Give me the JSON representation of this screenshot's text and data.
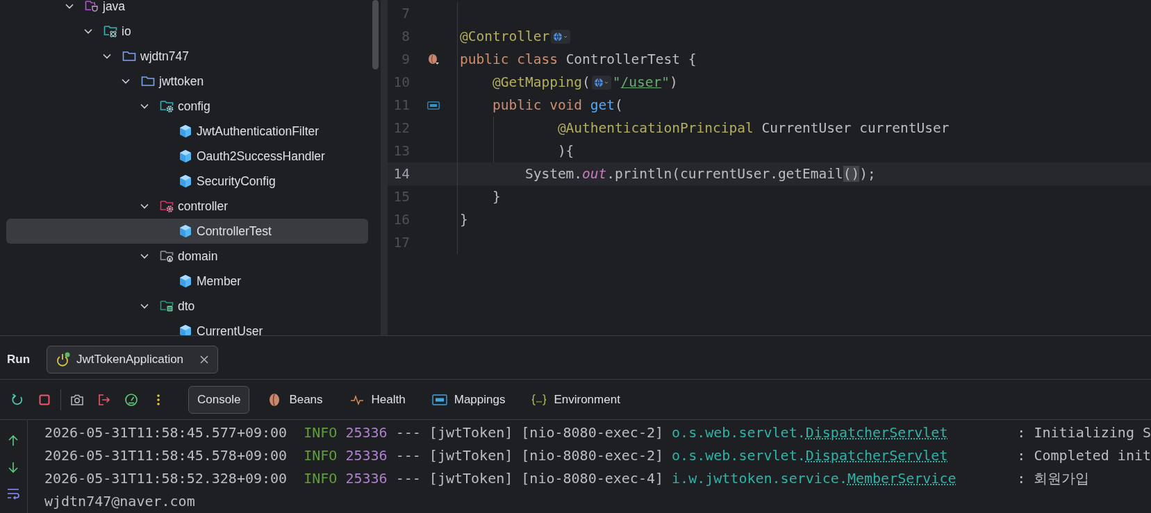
{
  "tree": [
    {
      "label": "java",
      "kind": "source-root",
      "expanded": true,
      "selected": false,
      "children": [
        {
          "label": "io",
          "kind": "atom-package",
          "expanded": true,
          "selected": false,
          "children": [
            {
              "label": "wjdtn747",
              "kind": "folder",
              "expanded": true,
              "selected": false,
              "children": [
                {
                  "label": "jwttoken",
                  "kind": "folder",
                  "expanded": true,
                  "selected": false,
                  "children": [
                    {
                      "label": "config",
                      "kind": "config-folder",
                      "expanded": true,
                      "selected": false,
                      "children": [
                        {
                          "label": "JwtAuthenticationFilter",
                          "kind": "class",
                          "selected": false
                        },
                        {
                          "label": "Oauth2SuccessHandler",
                          "kind": "class",
                          "selected": false
                        },
                        {
                          "label": "SecurityConfig",
                          "kind": "class",
                          "selected": false
                        }
                      ]
                    },
                    {
                      "label": "controller",
                      "kind": "controller-folder",
                      "expanded": true,
                      "selected": false,
                      "children": [
                        {
                          "label": "ControllerTest",
                          "kind": "class",
                          "selected": true
                        }
                      ]
                    },
                    {
                      "label": "domain",
                      "kind": "domain-folder",
                      "expanded": true,
                      "selected": false,
                      "children": [
                        {
                          "label": "Member",
                          "kind": "class",
                          "selected": false
                        }
                      ]
                    },
                    {
                      "label": "dto",
                      "kind": "dto-folder",
                      "expanded": true,
                      "selected": false,
                      "children": [
                        {
                          "label": "CurrentUser",
                          "kind": "class",
                          "selected": false
                        }
                      ]
                    }
                  ]
                }
              ]
            }
          ]
        }
      ]
    }
  ],
  "editor": {
    "lines": [
      {
        "number": "7",
        "kind": "plain",
        "current": false
      },
      {
        "number": "8",
        "kind": "plain",
        "current": false,
        "tokens": [
          {
            "kind": "annotation",
            "text": "@Controller"
          },
          {
            "kind": "inlay"
          }
        ]
      },
      {
        "number": "9",
        "kind": "bean",
        "current": false,
        "tokens": [
          {
            "kind": "keyword",
            "text": "public class "
          },
          {
            "kind": "plain",
            "text": "ControllerTest {"
          }
        ]
      },
      {
        "number": "10",
        "kind": "plain",
        "current": false,
        "tokens": [
          {
            "kind": "annotation",
            "text": "    @GetMapping"
          },
          {
            "kind": "plain",
            "text": "("
          },
          {
            "kind": "inlay"
          },
          {
            "kind": "string",
            "text": "\""
          },
          {
            "kind": "link",
            "text": "/user"
          },
          {
            "kind": "string",
            "text": "\""
          },
          {
            "kind": "plain",
            "text": ")"
          }
        ]
      },
      {
        "number": "11",
        "kind": "api",
        "current": false,
        "tokens": [
          {
            "kind": "keyword",
            "text": "    public void "
          },
          {
            "kind": "method",
            "text": "get"
          },
          {
            "kind": "plain",
            "text": "("
          }
        ]
      },
      {
        "number": "12",
        "kind": "plain",
        "current": false,
        "tokens": [
          {
            "kind": "annotation",
            "text": "            @AuthenticationPrincipal "
          },
          {
            "kind": "plain",
            "text": "CurrentUser currentUser"
          }
        ]
      },
      {
        "number": "13",
        "kind": "plain",
        "current": false,
        "tokens": [
          {
            "kind": "plain",
            "text": "            ){"
          }
        ]
      },
      {
        "number": "14",
        "kind": "plain",
        "current": true,
        "tokens": [
          {
            "kind": "plain",
            "text": "        System."
          },
          {
            "kind": "field",
            "text": "out"
          },
          {
            "kind": "plain",
            "text": ".println(currentUser.getEmail"
          },
          {
            "kind": "match",
            "text": "()"
          },
          {
            "kind": "plain",
            "text": ");"
          }
        ]
      },
      {
        "number": "15",
        "kind": "plain",
        "current": false,
        "tokens": [
          {
            "kind": "plain",
            "text": "    }"
          }
        ]
      },
      {
        "number": "16",
        "kind": "plain",
        "current": false,
        "tokens": [
          {
            "kind": "plain",
            "text": "}"
          }
        ]
      },
      {
        "number": "17",
        "kind": "plain",
        "current": false
      }
    ]
  },
  "run": {
    "title": "Run",
    "tab": {
      "label": "JwtTokenApplication",
      "running": true
    },
    "view_tabs": [
      {
        "label": "Console",
        "kind": "console",
        "selected": true
      },
      {
        "label": "Beans",
        "kind": "bean",
        "selected": false
      },
      {
        "label": "Health",
        "kind": "health",
        "selected": false
      },
      {
        "label": "Mappings",
        "kind": "api",
        "selected": false
      },
      {
        "label": "Environment",
        "kind": "braces",
        "selected": false
      }
    ],
    "console": [
      {
        "tokens": [
          {
            "kind": "plain",
            "text": "2026-05-31T11:58:45.577+09:00  "
          },
          {
            "kind": "level",
            "text": "INFO"
          },
          {
            "kind": "pid",
            "text": "25336"
          },
          {
            "kind": "plain",
            "text": " --- [jwtToken] [nio-8080-exec-2] "
          },
          {
            "kind": "logger",
            "text": "o.s.web.servlet.",
            "link": "DispatcherServlet"
          },
          {
            "kind": "plain",
            "text": ": Initializing S"
          }
        ]
      },
      {
        "tokens": [
          {
            "kind": "plain",
            "text": "2026-05-31T11:58:45.578+09:00  "
          },
          {
            "kind": "level",
            "text": "INFO"
          },
          {
            "kind": "pid",
            "text": "25336"
          },
          {
            "kind": "plain",
            "text": " --- [jwtToken] [nio-8080-exec-2] "
          },
          {
            "kind": "logger",
            "text": "o.s.web.servlet.",
            "link": "DispatcherServlet"
          },
          {
            "kind": "plain",
            "text": ": Completed init"
          }
        ]
      },
      {
        "tokens": [
          {
            "kind": "plain",
            "text": "2026-05-31T11:58:52.328+09:00  "
          },
          {
            "kind": "level",
            "text": "INFO"
          },
          {
            "kind": "pid",
            "text": "25336"
          },
          {
            "kind": "plain",
            "text": " --- [jwtToken] [nio-8080-exec-4] "
          },
          {
            "kind": "logger",
            "text": "i.w.jwttoken.service.",
            "link": "MemberService"
          },
          {
            "kind": "plain",
            "text": ": 회원가입"
          }
        ]
      },
      {
        "tokens": [
          {
            "kind": "plain",
            "text": "wjdtn747@naver.com"
          }
        ]
      }
    ]
  }
}
